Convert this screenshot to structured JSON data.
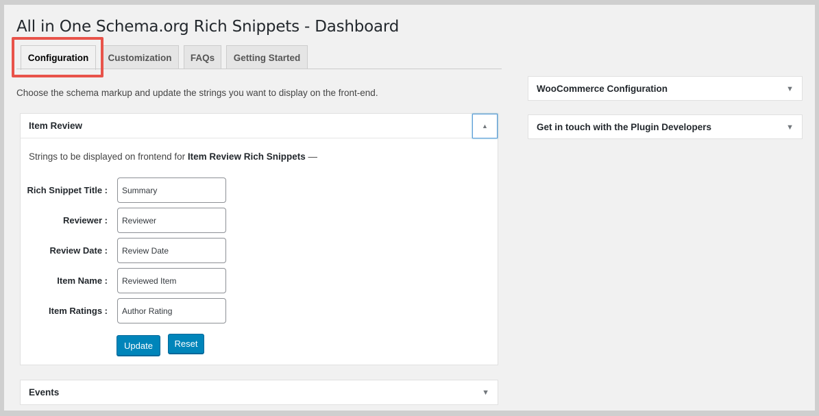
{
  "page": {
    "title": "All in One Schema.org Rich Snippets - Dashboard",
    "intro": "Choose the schema markup and update the strings you want to display on the front-end."
  },
  "tabs": [
    {
      "label": "Configuration",
      "active": true
    },
    {
      "label": "Customization",
      "active": false
    },
    {
      "label": "FAQs",
      "active": false
    },
    {
      "label": "Getting Started",
      "active": false
    }
  ],
  "item_review": {
    "title": "Item Review",
    "desc_prefix": "Strings to be displayed on frontend for ",
    "desc_bold": "Item Review Rich Snippets",
    "desc_suffix": " —",
    "fields": [
      {
        "label": "Rich Snippet Title :",
        "value": "Summary"
      },
      {
        "label": "Reviewer :",
        "value": "Reviewer"
      },
      {
        "label": "Review Date :",
        "value": "Review Date"
      },
      {
        "label": "Item Name :",
        "value": "Reviewed Item"
      },
      {
        "label": "Item Ratings :",
        "value": "Author Rating"
      }
    ],
    "update_label": "Update",
    "reset_label": "Reset"
  },
  "events": {
    "title": "Events"
  },
  "sidebar": {
    "woocommerce": "WooCommerce Configuration",
    "contact": "Get in touch with the Plugin Developers"
  },
  "icons": {
    "collapse": "triangle-up-icon",
    "expand": "triangle-down-icon"
  },
  "colors": {
    "primary_button": "#0085ba",
    "highlight": "#e8534a",
    "background": "#f1f1f1"
  }
}
